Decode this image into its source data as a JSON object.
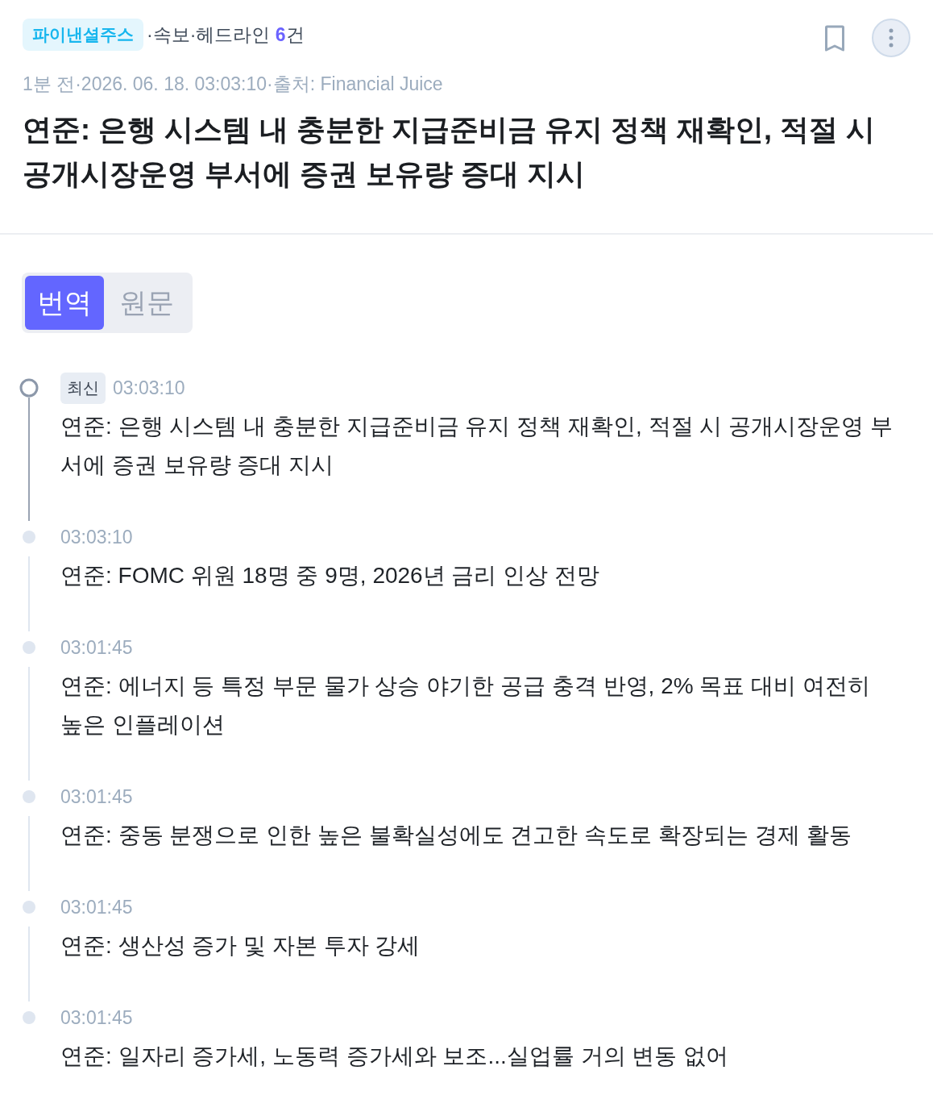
{
  "header": {
    "source_tag": "파이낸셜주스",
    "summary": "·속보·헤드라인 **6**건",
    "meta": "1분 전·2026. 06. 18. 03:03:10·출처: Financial Juice",
    "title": "연준: 은행 시스템 내 충분한 지급준비금 유지 정책 재확인, 적절 시 공개시장운영 부서에 증권 보유량 증대 지시"
  },
  "tabs": [
    {
      "label": "번역",
      "selected": true
    },
    {
      "label": "원문",
      "selected": false
    }
  ],
  "timeline": [
    {
      "latest": true,
      "badge": "최신",
      "time": "03:03:10",
      "text": "연준: 은행 시스템 내 충분한 지급준비금 유지 정책 재확인, 적절 시 공개시장운영 부서에 증권 보유량 증대 지시"
    },
    {
      "latest": false,
      "time": "03:03:10",
      "text": "연준: FOMC 위원 18명 중 9명, 2026년 금리 인상 전망"
    },
    {
      "latest": false,
      "time": "03:01:45",
      "text": "연준: 에너지 등 특정 부문 물가 상승 야기한 공급 충격 반영, 2% 목표 대비 여전히 높은 인플레이션"
    },
    {
      "latest": false,
      "time": "03:01:45",
      "text": "연준: 중동 분쟁으로 인한 높은 불확실성에도 견고한 속도로 확장되는 경제 활동"
    },
    {
      "latest": false,
      "time": "03:01:45",
      "text": "연준: 생산성 증가 및 자본 투자 강세"
    },
    {
      "latest": false,
      "time": "03:01:45",
      "text": "연준: 일자리 증가세, 노동력 증가세와 보조...실업률 거의 변동 없어"
    }
  ]
}
